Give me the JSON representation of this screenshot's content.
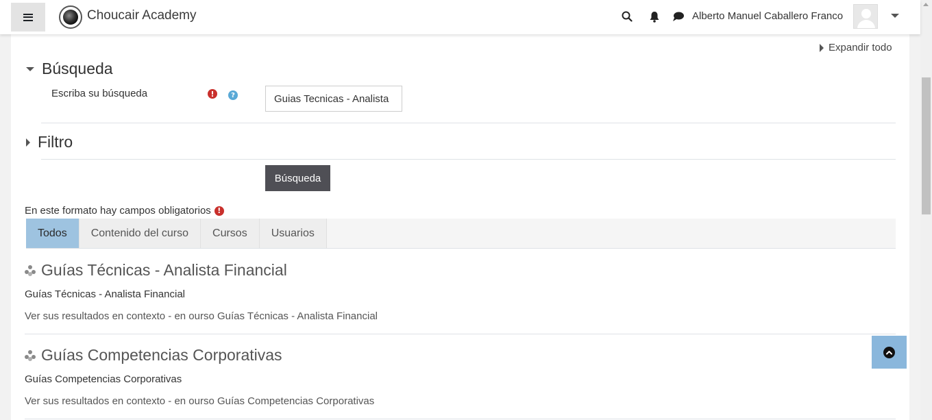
{
  "header": {
    "site_name": "Choucair Academy",
    "user_name": "Alberto Manuel Caballero Franco",
    "icons": [
      "menu-icon",
      "search-icon",
      "bell-icon",
      "chat-icon",
      "avatar",
      "chevron-down-icon"
    ]
  },
  "form": {
    "expand_all": "Expandir todo",
    "search_section_title": "Búsqueda",
    "search_label": "Escriba su búsqueda",
    "required_symbol": "!",
    "help_symbol": "?",
    "search_value": "Guias Tecnicas - Analista",
    "filter_section_title": "Filtro",
    "search_button": "Búsqueda",
    "required_note": "En este formato hay campos obligatorios"
  },
  "tabs": [
    {
      "label": "Todos",
      "active": true
    },
    {
      "label": "Contenido del curso",
      "active": false
    },
    {
      "label": "Cursos",
      "active": false
    },
    {
      "label": "Usuarios",
      "active": false
    }
  ],
  "results": [
    {
      "title": "Guías Técnicas - Analista Financial",
      "subtitle": "Guías Técnicas - Analista Financial",
      "context": "Ver sus resultados en contexto - en ourso Guías Técnicas - Analista Financial"
    },
    {
      "title": "Guías Competencias Corporativas",
      "subtitle": "Guías Competencias Corporativas",
      "context": "Ver sus resultados en contexto - en ourso Guías Competencias Corporativas"
    }
  ],
  "colors": {
    "active_tab": "#9ec3e0",
    "search_button": "#4f4f55",
    "required": "#c9302c",
    "help": "#5aa9d6",
    "back_to_top": "#8ab7dc"
  }
}
